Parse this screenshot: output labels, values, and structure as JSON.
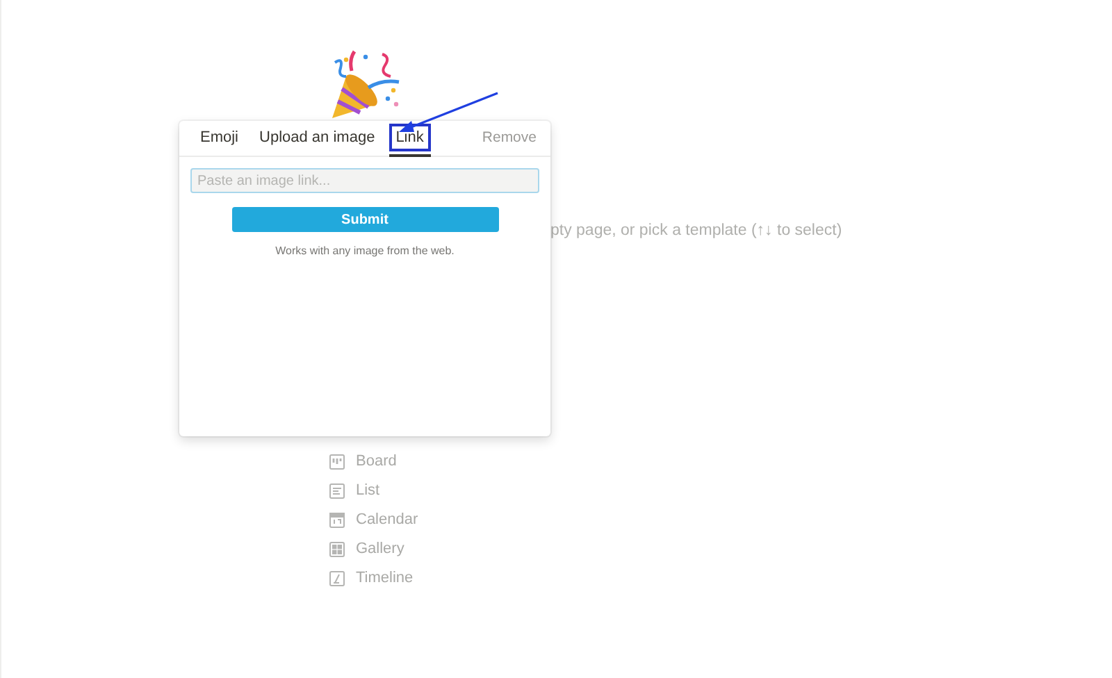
{
  "page": {
    "hint": "pty page, or pick a template (↑↓ to select)",
    "templates": [
      {
        "kind": "board",
        "label": "Board"
      },
      {
        "kind": "list",
        "label": "List"
      },
      {
        "kind": "calendar",
        "label": "Calendar"
      },
      {
        "kind": "gallery",
        "label": "Gallery"
      },
      {
        "kind": "timeline",
        "label": "Timeline"
      }
    ]
  },
  "popup": {
    "tabs": [
      {
        "label": "Emoji",
        "selected": false,
        "highlighted": false
      },
      {
        "label": "Upload an image",
        "selected": false,
        "highlighted": false
      },
      {
        "label": "Link",
        "selected": true,
        "highlighted": true
      }
    ],
    "remove": "Remove",
    "link_field": {
      "placeholder": "Paste an image link..."
    },
    "submit": "Submit",
    "note": "Works with any image from the web."
  }
}
